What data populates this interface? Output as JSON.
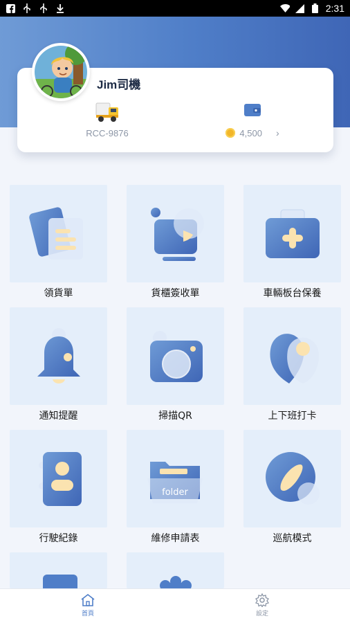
{
  "status_bar": {
    "time": "2:31",
    "left_icons": [
      "facebook-icon",
      "usb-icon",
      "usb-icon",
      "download-icon"
    ],
    "right_icons": [
      "wifi-icon",
      "signal-icon",
      "battery-icon"
    ]
  },
  "profile": {
    "name": "Jim司機",
    "plate": "RCC-9876",
    "balance": "4,500",
    "balance_chevron": "›"
  },
  "tiles": [
    {
      "label": "領貨單",
      "icon": "documents-icon"
    },
    {
      "label": "貨櫃簽收單",
      "icon": "monitor-play-icon"
    },
    {
      "label": "車輛板台保養",
      "icon": "medical-kit-icon"
    },
    {
      "label": "通知提醒",
      "icon": "bell-icon"
    },
    {
      "label": "掃描QR",
      "icon": "camera-icon"
    },
    {
      "label": "上下班打卡",
      "icon": "location-pin-icon"
    },
    {
      "label": "行駛紀錄",
      "icon": "contact-book-icon"
    },
    {
      "label": "維修申請表",
      "icon": "folder-icon",
      "icon_text": "folder"
    },
    {
      "label": "巡航模式",
      "icon": "compass-icon"
    },
    {
      "label": "",
      "icon": "document-icon"
    },
    {
      "label": "",
      "icon": "gear-icon"
    }
  ],
  "colors": {
    "header_start": "#6f9bd6",
    "header_end": "#3f66b6",
    "tile_bg": "#e4eefa",
    "icon_blue": "#4f7ec8",
    "accent_cream": "#fbe3b0"
  },
  "bottom_nav": [
    {
      "label": "首頁",
      "icon": "home-icon",
      "active": true
    },
    {
      "label": "設定",
      "icon": "gear-icon",
      "active": false
    }
  ]
}
